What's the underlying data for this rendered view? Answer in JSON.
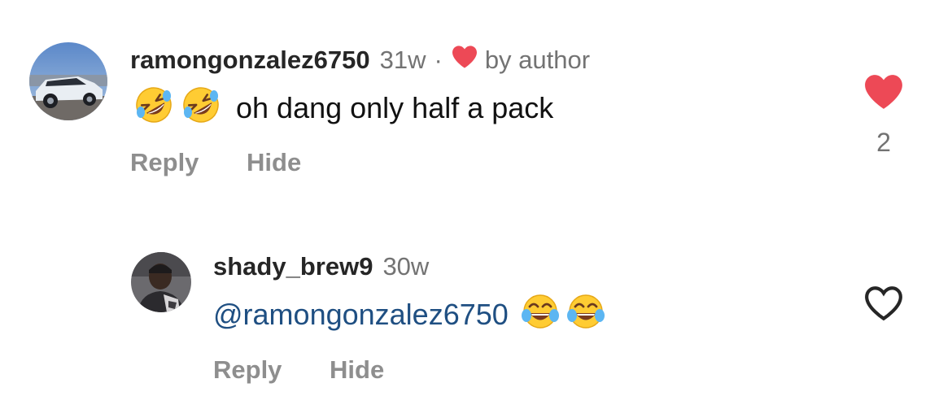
{
  "comments": [
    {
      "username": "ramongonzalez6750",
      "time": "31w",
      "separator": "·",
      "author_badge": "by author",
      "text": "oh dang only half a pack",
      "emoji": [
        "rolling-on-floor-laughing",
        "rolling-on-floor-laughing"
      ],
      "reply_label": "Reply",
      "hide_label": "Hide",
      "liked": true,
      "like_count": "2",
      "avatar": "car-photo"
    },
    {
      "username": "shady_brew9",
      "time": "30w",
      "mention": "@ramongonzalez6750",
      "emoji": [
        "face-with-tears-of-joy",
        "face-with-tears-of-joy"
      ],
      "reply_label": "Reply",
      "hide_label": "Hide",
      "liked": false,
      "avatar": "person-photo"
    }
  ],
  "colors": {
    "heart_red": "#ed4956",
    "link_blue": "#1f4f82",
    "secondary_text": "#737373"
  }
}
